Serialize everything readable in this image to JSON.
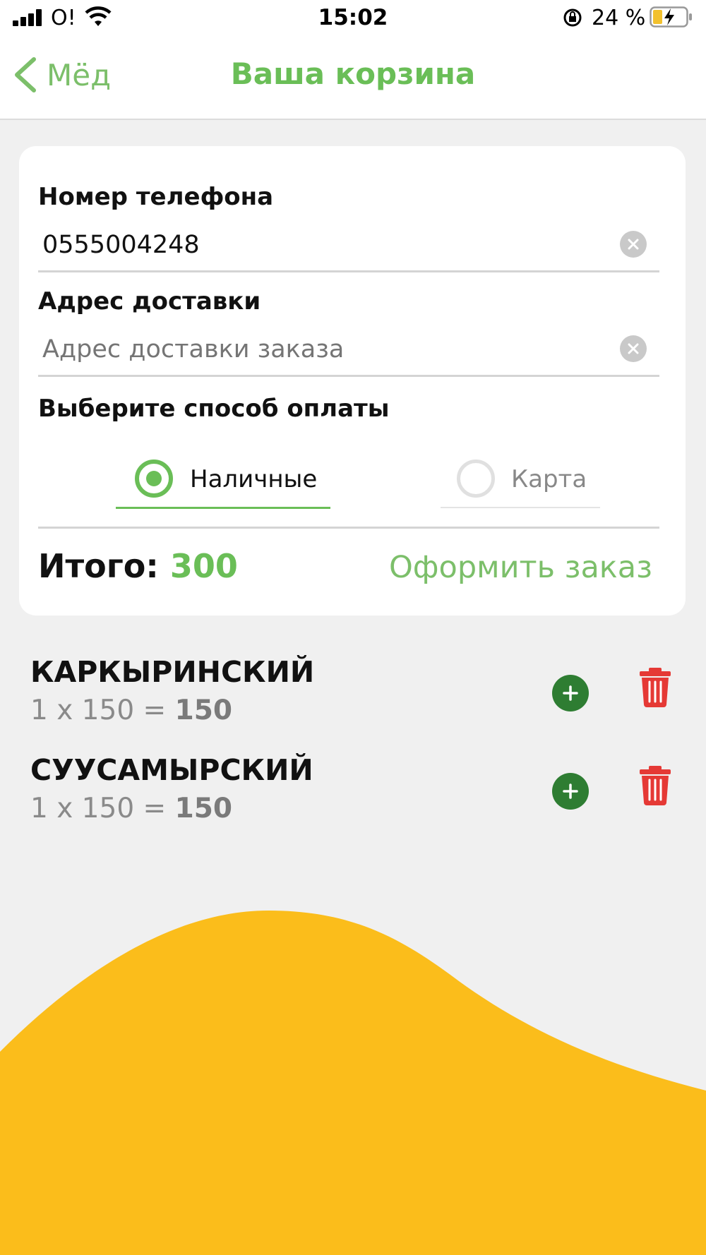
{
  "status_bar": {
    "carrier": "O!",
    "time": "15:02",
    "battery_percent": "24 %"
  },
  "nav": {
    "back_label": "Мёд",
    "title": "Ваша корзина"
  },
  "form": {
    "phone_label": "Номер телефона",
    "phone_value": "0555004248",
    "address_label": "Адрес доставки",
    "address_placeholder": "Адрес доставки заказа",
    "payment_label": "Выберите способ оплаты",
    "payment_options": [
      {
        "label": "Наличные",
        "selected": true
      },
      {
        "label": "Карта",
        "selected": false
      }
    ],
    "total_label": "Итого:",
    "total_value": "300",
    "checkout_label": "Оформить заказ"
  },
  "cart": {
    "items": [
      {
        "name": "КАРКЫРИНСКИЙ",
        "quantity_price": "1 x 150 = ",
        "subtotal": "150"
      },
      {
        "name": "СУУСАМЫРСКИЙ",
        "quantity_price": "1 x 150 = ",
        "subtotal": "150"
      }
    ]
  },
  "colors": {
    "accent_green": "#6abe57",
    "add_button_green": "#2e7d32",
    "delete_red": "#e53935",
    "wave_yellow": "#fbbd1b",
    "background": "#f0f0f0"
  },
  "icons": {
    "back": "chevron-left-icon",
    "clear": "clear-circle-icon",
    "add": "plus-circle-icon",
    "delete": "trash-icon"
  }
}
